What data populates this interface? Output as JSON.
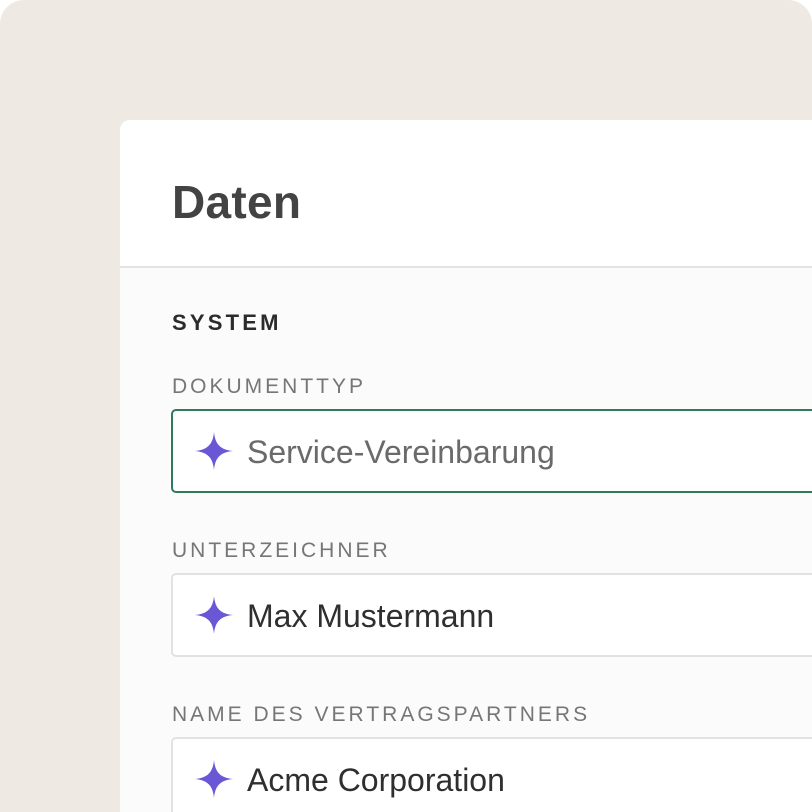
{
  "panel": {
    "title": "Daten"
  },
  "section": {
    "title": "SYSTEM"
  },
  "fields": [
    {
      "label": "DOKUMENTTYP",
      "value": "Service-Vereinbarung",
      "icon": "sparkle-icon",
      "focused": true
    },
    {
      "label": "UNTERZEICHNER",
      "value": "Max Mustermann",
      "icon": "sparkle-icon",
      "focused": false
    },
    {
      "label": "NAME DES VERTRAGSPARTNERS",
      "value": "Acme Corporation",
      "icon": "sparkle-icon",
      "focused": false
    }
  ],
  "colors": {
    "background": "#eeeae3",
    "accent_icon": "#6a57d6",
    "focus_border": "#2d7c5c"
  }
}
